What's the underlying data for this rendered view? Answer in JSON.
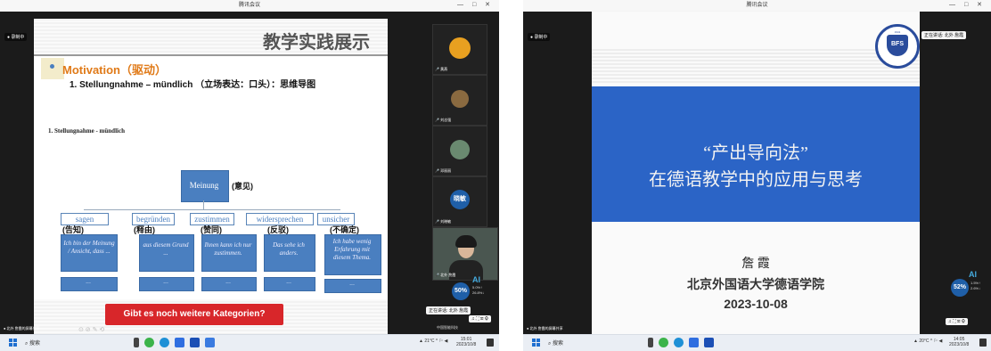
{
  "left": {
    "window_title": "腾讯会议",
    "recording_label": "录制中",
    "slide": {
      "title": "教学实践展示",
      "bullet": "Motivation（驱动）",
      "heading": "1. Stellungnahme – mündlich （立场表达：口头）：思维导图",
      "subheading": "1.  Stellungnahme - mündlich",
      "center_node": "Meinung",
      "center_node_zh": "(意见)",
      "branches": [
        {
          "de": "sagen",
          "zh": "(告知)",
          "example": "Ich bin der Meinung / Ansicht, dass ...",
          "more": "..."
        },
        {
          "de": "begründen",
          "zh": "(释由)",
          "example": "aus diesem Grund ...",
          "more": "..."
        },
        {
          "de": "zustimmen",
          "zh": "(赞同)",
          "example": "Ihnen kann ich nur zustimmen.",
          "more": "..."
        },
        {
          "de": "widersprechen",
          "zh": "(反驳)",
          "example": "Das sehe ich anders.",
          "more": "..."
        },
        {
          "de": "unsicher",
          "zh": "(不确定)",
          "example": "Ich habe wenig Erfahrung mit diesem Thema.",
          "more": "..."
        }
      ],
      "bottom_banner": "Gibt es noch weitere Kategorien?"
    },
    "participants": [
      {
        "name": "黄燕",
        "avatar_color": "#e8a020"
      },
      {
        "name": "刘志强",
        "avatar_color": "#8a6a40"
      },
      {
        "name": "邓丽丽",
        "avatar_color": "#6a8a70"
      },
      {
        "name": "刘晓敏",
        "avatar_text": "晓敏",
        "avatar_color": "#2b6cc4"
      },
      {
        "name": "北外 詹霞",
        "avatar_color": "#3a4a40"
      }
    ],
    "presenter_label": "北外 詹霞的屏幕共享",
    "cpu_badge": "50%",
    "ai_label": "AI",
    "cpu_stats": [
      "5.0%↑",
      "26.8%↓"
    ],
    "bottom_label": "中国智能科技",
    "nav_label": "正在讲话: 北外 詹霞",
    "taskbar": {
      "search": "搜索",
      "weather": "21°C",
      "time": "15:01",
      "date": "2023/10/8"
    }
  },
  "right": {
    "window_title": "腾讯会议",
    "recording_label": "录制中",
    "speaking_label": "正在讲话: 北外 詹霞",
    "slide": {
      "title_line1": "“产出导向法”",
      "title_line2": "在德语教学中的应用与思考",
      "author": "詹 霞",
      "affiliation": "北京外国语大学德语学院",
      "date": "2023-10-08",
      "logo_text": "BFS",
      "logo_year": "1941"
    },
    "cpu_badge": "52%",
    "ai_label": "AI",
    "cpu_stats": [
      "1.5%↑",
      "2.6%↓"
    ],
    "presenter_label": "北外 詹霞的屏幕共享",
    "taskbar": {
      "search": "搜索",
      "weather": "20°C",
      "time": "14:05",
      "date": "2023/10/8"
    }
  },
  "colors": {
    "slide_blue": "#2b64c6",
    "box_blue": "#4a7fc0",
    "orange": "#e07a18",
    "banner_red": "#d8262a"
  }
}
